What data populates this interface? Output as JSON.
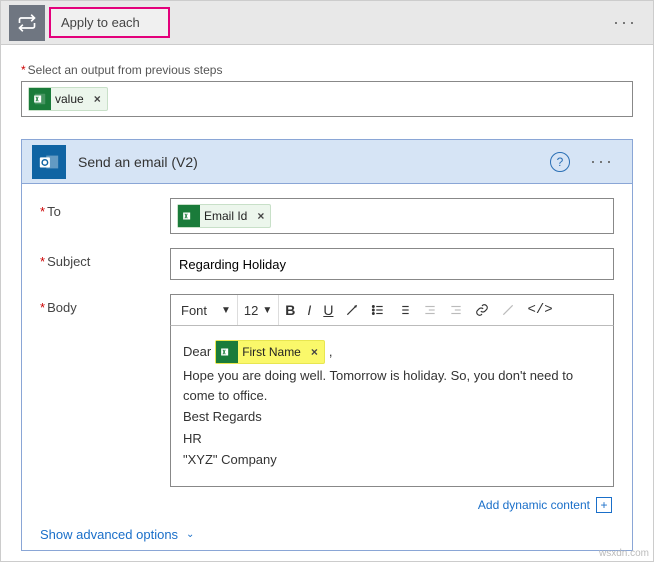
{
  "outer": {
    "title": "Apply to each",
    "select_label": "Select an output from previous steps",
    "value_token": "value"
  },
  "email": {
    "title": "Send an email (V2)",
    "to_label": "To",
    "to_token": "Email Id",
    "subject_label": "Subject",
    "subject_value": "Regarding Holiday",
    "body_label": "Body",
    "toolbar": {
      "font": "Font",
      "size": "12"
    },
    "body_content": {
      "dear": "Dear",
      "first_name_token": "First Name",
      "comma": ",",
      "line1": "Hope you are doing well. Tomorrow is holiday. So, you don't need to come to office.",
      "line2": "Best Regards",
      "line3": "HR",
      "line4": "\"XYZ\" Company"
    },
    "dynamic_link": "Add dynamic content",
    "advanced_link": "Show advanced options"
  },
  "watermark": "wsxdn.com"
}
